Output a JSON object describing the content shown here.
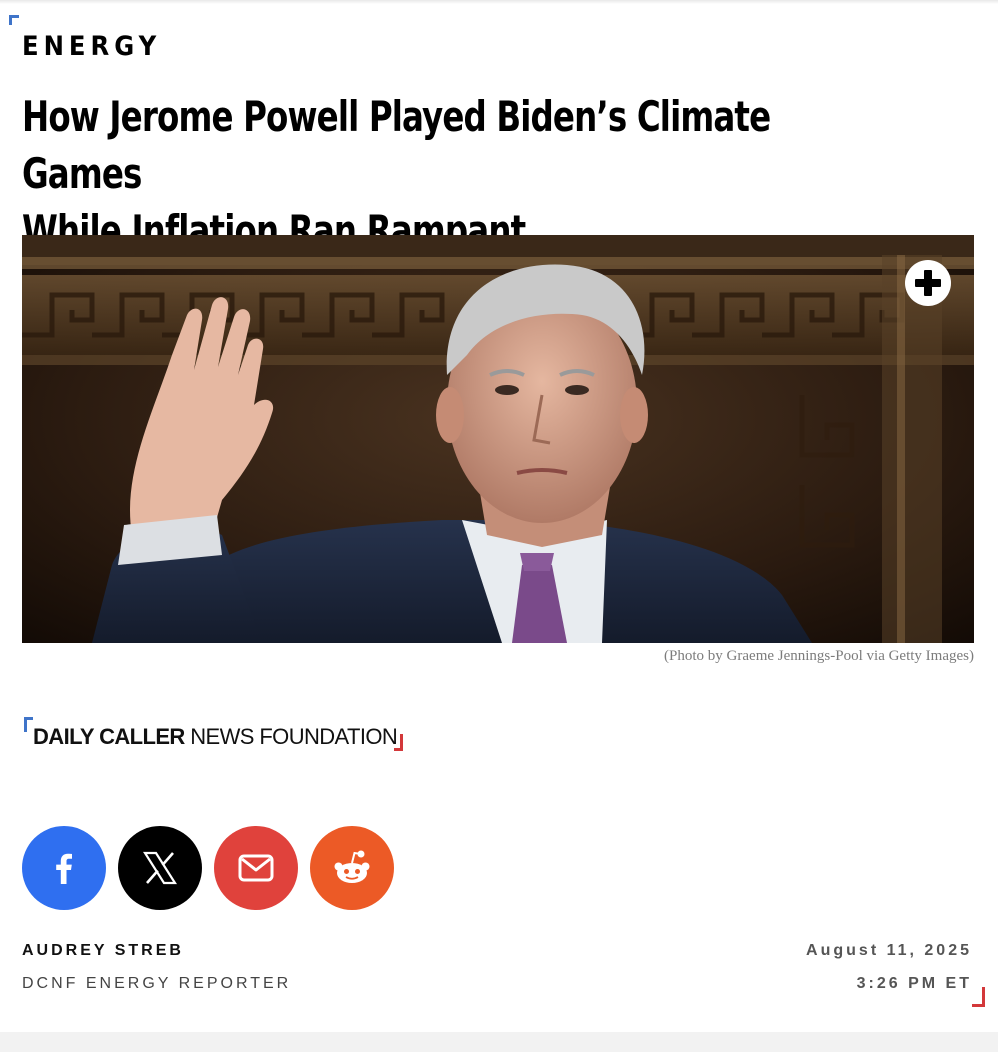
{
  "article": {
    "category": "ENERGY",
    "headline_line1": "How Jerome Powell Played Biden’s Climate Games",
    "headline_line2": "While Inflation Ran Rampant",
    "photo_caption": "(Photo by Graeme Jennings-Pool via Getty Images)"
  },
  "source_logo": {
    "strong": "DAILY CALLER",
    "light": " NEWS FOUNDATION"
  },
  "share": {
    "buttons": [
      "facebook-icon",
      "x-icon",
      "email-icon",
      "reddit-icon"
    ]
  },
  "byline": {
    "author": "AUDREY STREB",
    "role": "DCNF ENERGY REPORTER",
    "date": "August 11, 2025",
    "time": "3:26 PM ET"
  },
  "colors": {
    "brand_blue": "#3f74c9",
    "brand_red": "#d3383a",
    "facebook": "#2f6ff0",
    "x": "#000000",
    "email": "#e0423c",
    "reddit": "#ec5a26"
  }
}
